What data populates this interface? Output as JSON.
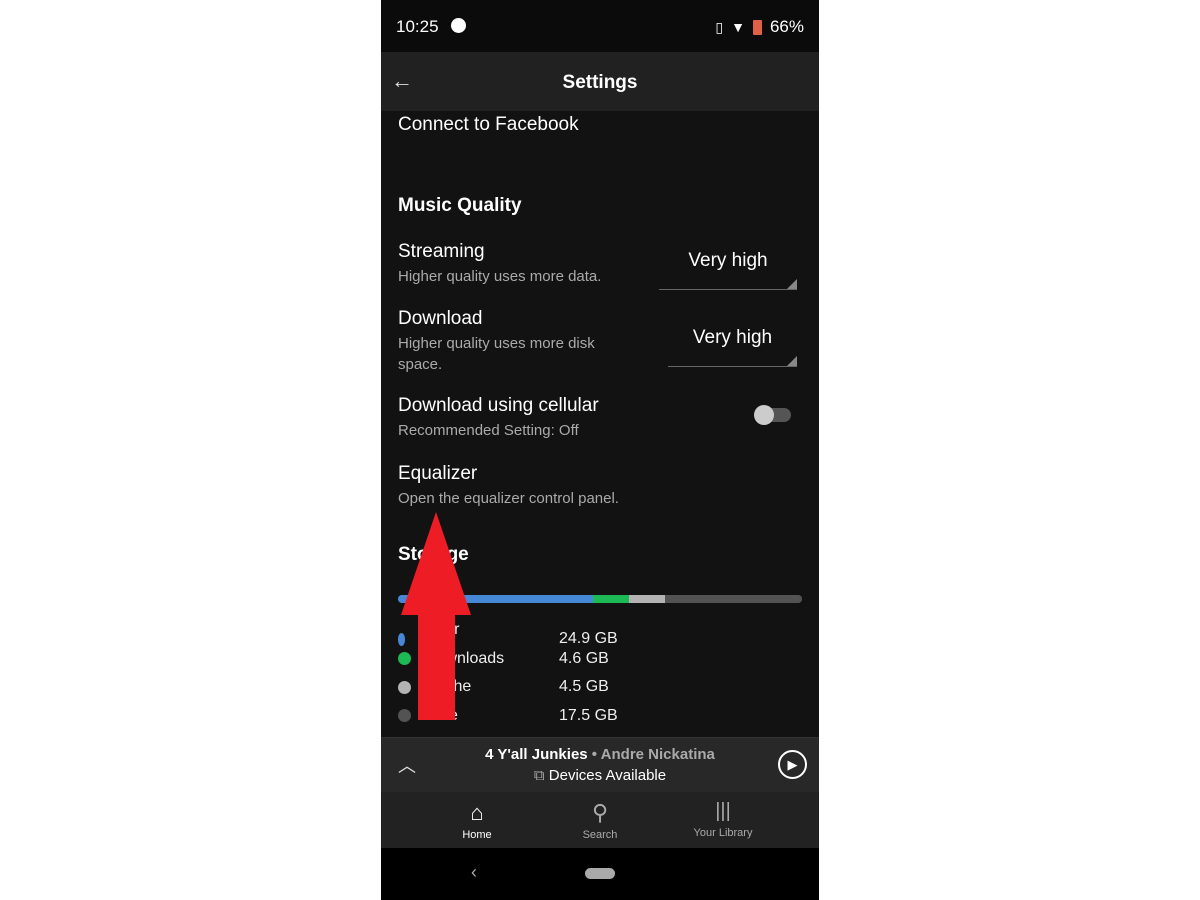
{
  "status": {
    "time": "10:25",
    "battery": "66%"
  },
  "header": {
    "title": "Settings"
  },
  "connect_facebook": "Connect to Facebook",
  "music_quality": {
    "heading": "Music Quality",
    "streaming": {
      "title": "Streaming",
      "subtitle": "Higher quality uses more data.",
      "value": "Very high"
    },
    "download": {
      "title": "Download",
      "subtitle": "Higher quality uses more disk space.",
      "value": "Very high"
    },
    "cellular": {
      "title": "Download using cellular",
      "subtitle": "Recommended Setting: Off",
      "on": false
    },
    "equalizer": {
      "title": "Equalizer",
      "subtitle": "Open the equalizer control panel."
    }
  },
  "storage": {
    "heading": "Storage",
    "items": [
      {
        "label": "Other apps",
        "value": "24.9 GB",
        "gb": 24.9,
        "color": "#4687d6"
      },
      {
        "label": "Downloads",
        "value": "4.6 GB",
        "gb": 4.6,
        "color": "#1db954"
      },
      {
        "label": "Cache",
        "value": "4.5 GB",
        "gb": 4.5,
        "color": "#b3b3b3"
      },
      {
        "label": "Free",
        "value": "17.5 GB",
        "gb": 17.5,
        "color": "#535353"
      }
    ]
  },
  "player": {
    "track": "4 Y'all Junkies",
    "artist": "Andre Nickatina",
    "separator": " • ",
    "devices": "Devices Available"
  },
  "nav": {
    "home": "Home",
    "search": "Search",
    "library": "Your Library"
  },
  "annotation": {
    "arrow_color": "#ee1c25",
    "direction": "up"
  }
}
